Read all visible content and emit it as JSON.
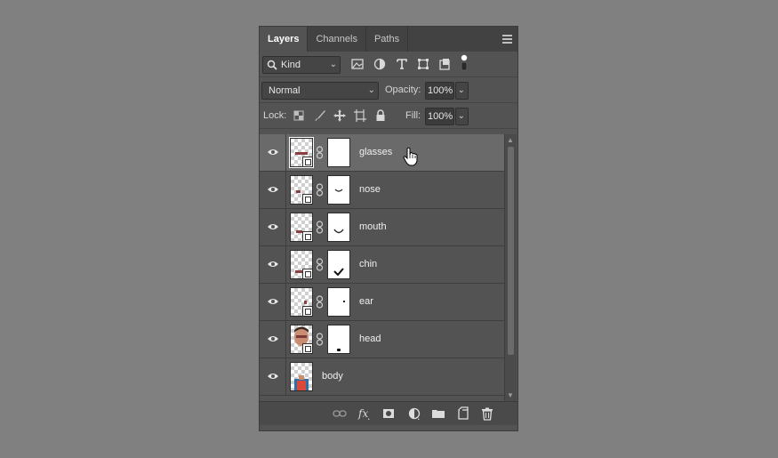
{
  "tabs": [
    {
      "label": "Layers",
      "active": true
    },
    {
      "label": "Channels",
      "active": false
    },
    {
      "label": "Paths",
      "active": false
    }
  ],
  "filter": {
    "label": "Kind"
  },
  "blend": {
    "mode": "Normal",
    "opacity_label": "Opacity:",
    "opacity_value": "100%"
  },
  "lock": {
    "label": "Lock:",
    "fill_label": "Fill:",
    "fill_value": "100%"
  },
  "layers": [
    {
      "name": "glasses",
      "selected": true,
      "has_mask": true
    },
    {
      "name": "nose",
      "selected": false,
      "has_mask": true
    },
    {
      "name": "mouth",
      "selected": false,
      "has_mask": true
    },
    {
      "name": "chin",
      "selected": false,
      "has_mask": true
    },
    {
      "name": "ear",
      "selected": false,
      "has_mask": true
    },
    {
      "name": "head",
      "selected": false,
      "has_mask": true
    },
    {
      "name": "body",
      "selected": false,
      "has_mask": false
    }
  ],
  "bottom_icons": [
    "link-layers-icon",
    "fx-icon",
    "add-mask-icon",
    "adjustment-layer-icon",
    "new-group-icon",
    "new-layer-icon",
    "delete-icon"
  ],
  "colors": {
    "panel": "#535353",
    "tabbar": "#424242",
    "selected_row": "#6a6a6a",
    "background": "#808080"
  }
}
